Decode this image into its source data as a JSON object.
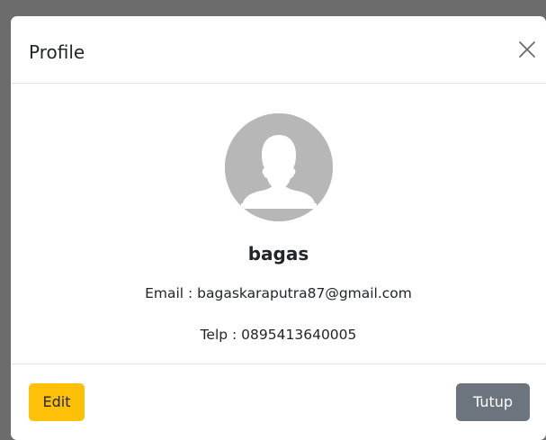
{
  "modal": {
    "title": "Profile",
    "close_icon": "close-icon"
  },
  "profile": {
    "avatar_icon": "user-silhouette-icon",
    "username": "bagas",
    "email_line": "Email : bagaskaraputra87@gmail.com",
    "phone_line": "Telp : 0895413640005"
  },
  "footer": {
    "edit_label": "Edit",
    "close_label": "Tutup"
  },
  "colors": {
    "edit_button": "#ffc107",
    "close_button": "#6c757d",
    "avatar_bg": "#b7b7b7",
    "backdrop": "#6c6c6c"
  }
}
